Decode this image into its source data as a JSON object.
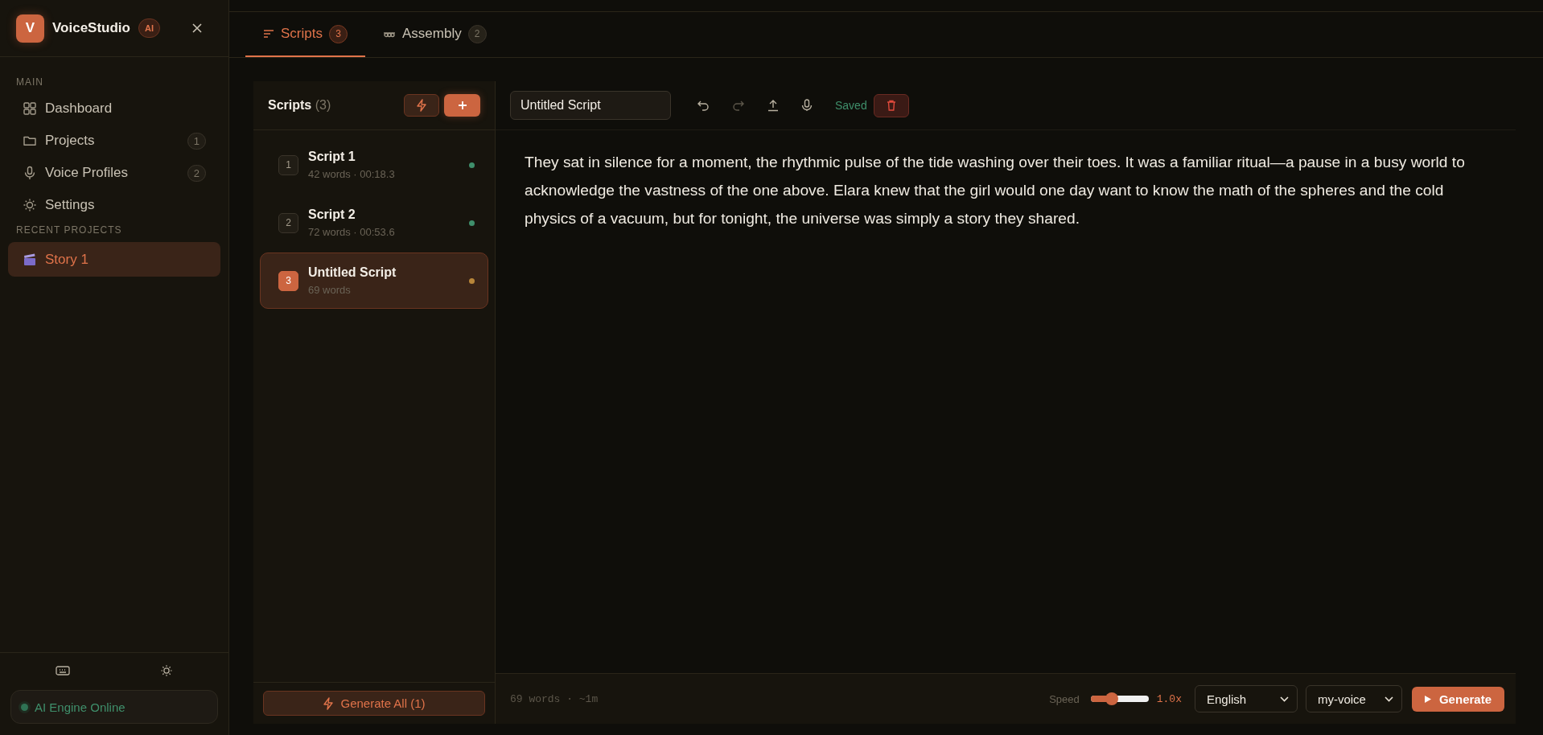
{
  "sidebar": {
    "brand": {
      "logo_letter": "V",
      "name": "VoiceStudio",
      "badge": "AI"
    },
    "sections": [
      {
        "title": "MAIN",
        "items": [
          {
            "label": "Dashboard",
            "kind": "grid",
            "selected": false
          },
          {
            "label": "Projects",
            "kind": "folder",
            "count": "1",
            "selected": false
          },
          {
            "label": "Voice Profiles",
            "kind": "mic",
            "count": "2",
            "selected": false
          },
          {
            "label": "Settings",
            "kind": "sun",
            "selected": false
          }
        ]
      },
      {
        "title": "RECENT PROJECTS",
        "items": [
          {
            "label": "Story 1",
            "kind": "clapper",
            "selected": true
          }
        ]
      }
    ],
    "engine_status": "AI Engine Online"
  },
  "tabs": [
    {
      "label": "Scripts",
      "kind": "lines",
      "count": "3",
      "selected": true
    },
    {
      "label": "Assembly",
      "kind": "chain",
      "count": "2",
      "selected": false
    }
  ],
  "scripts_panel": {
    "title": "Scripts",
    "count": "(3)",
    "items": [
      {
        "number": "1",
        "title": "Script 1",
        "meta": "42 words · 00:18.3",
        "selected": false,
        "color": "#3f8f6b"
      },
      {
        "number": "2",
        "title": "Script 2",
        "meta": "72 words · 00:53.6",
        "selected": false,
        "color": "#3f8f6b"
      },
      {
        "number": "3",
        "title": "Untitled Script",
        "meta": "69 words",
        "selected": true,
        "color": "#b8863a"
      }
    ],
    "generate_all": "Generate All (1)"
  },
  "editor": {
    "title_value": "Untitled Script",
    "saved": "Saved",
    "text": "They sat in silence for a moment, the rhythmic pulse of the tide washing over their toes. It was a familiar ritual—a pause in a busy world to acknowledge the vastness of the one above. Elara knew that the girl would one day want to know the math of the spheres and the cold physics of a vacuum, but for tonight, the universe was simply a story they shared.",
    "footer": {
      "stats": "69 words · ~1m",
      "speed_label": "Speed",
      "speed": {
        "level": 0.37
      },
      "speed_reading": "1.0x",
      "language": "English",
      "voice": "my-voice",
      "generate": "Generate"
    }
  }
}
